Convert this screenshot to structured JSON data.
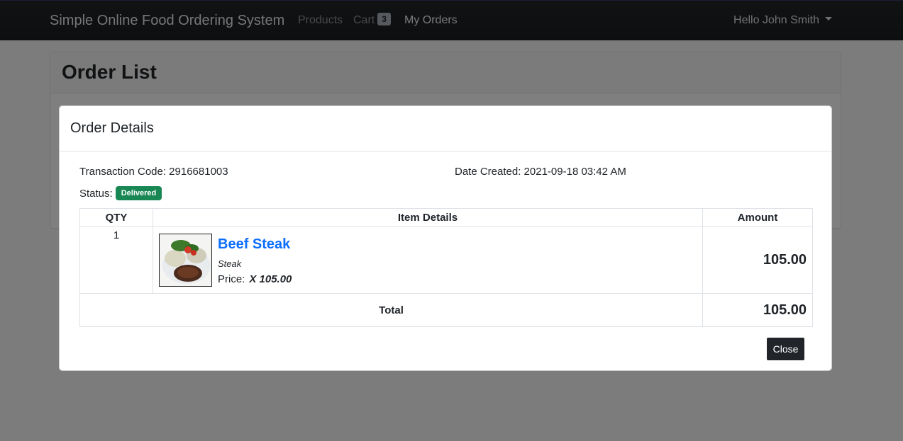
{
  "navbar": {
    "brand": "Simple Online Food Ordering System",
    "links": {
      "products": "Products",
      "cart": "Cart",
      "my_orders": "My Orders"
    },
    "cart_count": "3",
    "user": "Hello John Smith"
  },
  "page": {
    "title": "Order List"
  },
  "modal": {
    "title": "Order Details",
    "transaction_code": "Transaction Code: 2916681003",
    "date_created": "Date Created: 2021-09-18 03:42 AM",
    "status_label": "Status:",
    "status_value": "Delivered",
    "table": {
      "headers": {
        "qty": "QTY",
        "item": "Item Details",
        "amount": "Amount"
      },
      "rows": [
        {
          "qty": "1",
          "name": "Beef Steak",
          "category": "Steak",
          "price_label": "Price:",
          "price_value": "X 105.00",
          "amount": "105.00"
        }
      ],
      "total_label": "Total",
      "total_amount": "105.00"
    },
    "close_label": "Close"
  },
  "colors": {
    "navbar": "#212529",
    "link": "#0d6efd",
    "status": "#198754",
    "close_button": "#212529"
  }
}
